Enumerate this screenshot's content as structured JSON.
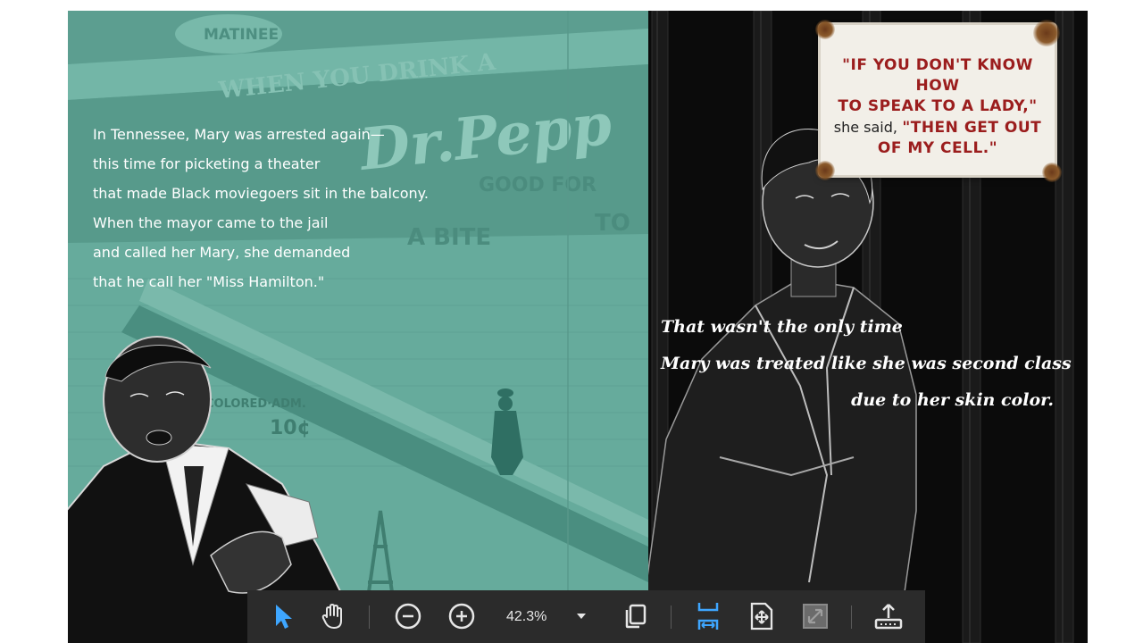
{
  "left_page": {
    "lines": [
      "In Tennessee, Mary was arrested again—",
      "this time for picketing a theater",
      "that made Black moviegoers sit in the balcony.",
      "When the mayor came to the jail",
      "and called her Mary, she demanded",
      "that he call her \"Miss Hamilton.\""
    ],
    "photo_signs": {
      "matinee": "MATINEE",
      "drink": "WHEN YOU DRINK A",
      "brand": "Dr.Pepp",
      "good_for": "GOOD FOR",
      "bite": "A BITE",
      "to": "TO",
      "colored": "COLORED·ADM.",
      "price": "10¢"
    }
  },
  "right_page": {
    "lines": [
      "That wasn't the only time",
      "Mary was treated like she was second class",
      "due to her skin color."
    ],
    "sign": {
      "quote_1a": "\"IF YOU DON'T KNOW HOW",
      "quote_1b": "TO SPEAK TO A LADY,\"",
      "said": "she said,",
      "quote_2a": "\"THEN GET OUT",
      "quote_2b": "OF MY CELL.\""
    }
  },
  "toolbar": {
    "tools": [
      {
        "name": "select-tool",
        "icon": "arrow-pointer-icon",
        "active": true
      },
      {
        "name": "pan-tool",
        "icon": "hand-icon",
        "active": false
      },
      {
        "name": "zoom-out",
        "icon": "minus-circle-icon",
        "active": false
      },
      {
        "name": "zoom-in",
        "icon": "plus-circle-icon",
        "active": false
      },
      {
        "name": "page-display",
        "icon": "copy-pages-icon",
        "active": false
      },
      {
        "name": "fit-width",
        "icon": "fit-width-icon",
        "active": true
      },
      {
        "name": "fit-page",
        "icon": "fit-page-icon",
        "active": false
      },
      {
        "name": "full-screen",
        "icon": "expand-icon",
        "active": false
      },
      {
        "name": "share",
        "icon": "share-upload-icon",
        "active": false
      }
    ],
    "zoom": "42.3%"
  },
  "colors": {
    "teal_page": "#63a899",
    "dark_page": "#0b0b0b",
    "toolbar_bg": "#2b2b2b",
    "accent_blue": "#3ea6ff",
    "sign_red": "#9b1d1d"
  }
}
